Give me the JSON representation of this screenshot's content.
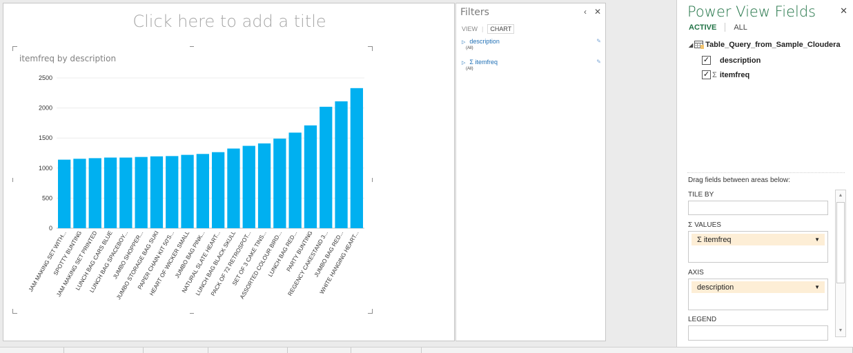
{
  "view": {
    "title_placeholder": "Click here to add a title"
  },
  "chart_data": {
    "type": "bar",
    "title": "itemfreq by description",
    "xlabel": "",
    "ylabel": "",
    "ylim": [
      0,
      2500
    ],
    "yticks": [
      0,
      500,
      1000,
      1500,
      2000,
      2500
    ],
    "bar_color": "#00b0f0",
    "categories": [
      "JAM MAKING SET WITH...",
      "SPOTTY BUNTING",
      "JAM MAKING SET PRINTED",
      "LUNCH BAG CARS BLUE",
      "LUNCH BAG SPACEBOY...",
      "JUMBO SHOPPER...",
      "JUMBO STORAGE BAG SUKI",
      "PAPER CHAIN KIT 50'S...",
      "HEART OF WICKER SMALL",
      "JUMBO BAG PINK...",
      "NATURAL SLATE HEART...",
      "LUNCH BAG BLACK SKULL",
      "PACK OF 72 RETROSPOT...",
      "SET OF 3 CAKE TINS...",
      "ASSORTED COLOUR BIRD...",
      "LUNCH BAG RED...",
      "PARTY BUNTING",
      "REGENCY CAKESTAND 3...",
      "JUMBO BAG RED...",
      "WHITE HANGING HEART..."
    ],
    "values": [
      1140,
      1155,
      1165,
      1175,
      1175,
      1185,
      1195,
      1200,
      1220,
      1235,
      1265,
      1325,
      1370,
      1410,
      1490,
      1590,
      1710,
      2020,
      2110,
      2330
    ],
    "grid": true,
    "legend": "none"
  },
  "filters": {
    "title": "Filters",
    "tab_view": "VIEW",
    "tab_chart": "CHART",
    "items": [
      {
        "name": "description",
        "value": "(All)"
      },
      {
        "name": "Σ itemfreq",
        "value": "(All)"
      }
    ],
    "minimize": "‹",
    "close": "✕"
  },
  "fields": {
    "title": "Power View Fields",
    "close": "✕",
    "tab_active": "ACTIVE",
    "tab_all": "ALL",
    "table_name": "Table_Query_from_Sample_Cloudera",
    "field1": "description",
    "field2": "itemfreq",
    "drag_label": "Drag fields between areas below:",
    "tile_by": "TILE BY",
    "values_label": "VALUES",
    "values_field": "itemfreq",
    "axis_label": "AXIS",
    "axis_field": "description",
    "legend_label": "LEGEND"
  }
}
